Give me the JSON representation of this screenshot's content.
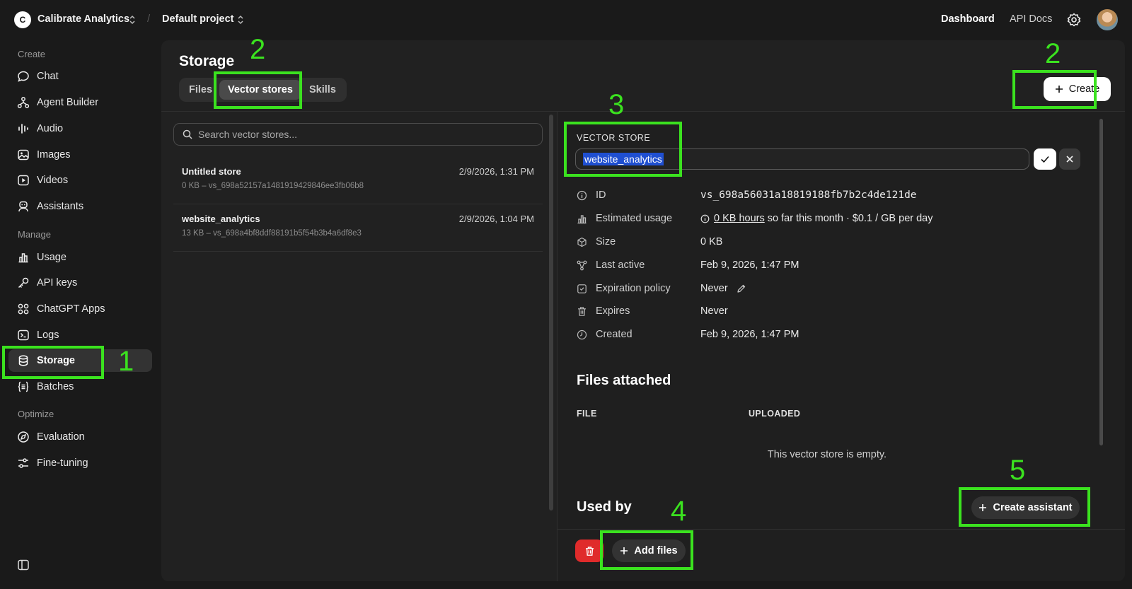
{
  "topbar": {
    "org_initial": "C",
    "org_name": "Calibrate Analytics",
    "separator": "/",
    "project_name": "Default project",
    "nav_dashboard": "Dashboard",
    "nav_api_docs": "API Docs"
  },
  "sidebar": {
    "sections": [
      "Create",
      "Manage",
      "Optimize"
    ],
    "items": [
      {
        "label": "Chat",
        "icon": "chat-icon"
      },
      {
        "label": "Agent Builder",
        "icon": "agent-builder-icon"
      },
      {
        "label": "Audio",
        "icon": "audio-icon"
      },
      {
        "label": "Images",
        "icon": "images-icon"
      },
      {
        "label": "Videos",
        "icon": "videos-icon"
      },
      {
        "label": "Assistants",
        "icon": "assistants-icon"
      },
      {
        "label": "Usage",
        "icon": "usage-icon"
      },
      {
        "label": "API keys",
        "icon": "key-icon"
      },
      {
        "label": "ChatGPT Apps",
        "icon": "apps-icon"
      },
      {
        "label": "Logs",
        "icon": "logs-icon"
      },
      {
        "label": "Storage",
        "icon": "database-icon",
        "active": true
      },
      {
        "label": "Batches",
        "icon": "batches-icon"
      },
      {
        "label": "Evaluation",
        "icon": "evaluation-icon"
      },
      {
        "label": "Fine-tuning",
        "icon": "fine-tuning-icon"
      }
    ]
  },
  "main": {
    "title": "Storage",
    "tabs": [
      {
        "label": "Files"
      },
      {
        "label": "Vector stores",
        "active": true
      },
      {
        "label": "Skills"
      }
    ],
    "create_label": "Create",
    "search_placeholder": "Search vector stores...",
    "stores": [
      {
        "name": "Untitled store",
        "date": "2/9/2026, 1:31 PM",
        "meta": "0 KB – vs_698a52157a1481919429846ee3fb06b8"
      },
      {
        "name": "website_analytics",
        "date": "2/9/2026, 1:04 PM",
        "meta": "13 KB – vs_698a4bf8ddf88191b5f54b3b4a6df8e3"
      }
    ]
  },
  "detail": {
    "section_label": "VECTOR STORE",
    "name_value": "website_analytics",
    "props": [
      {
        "label": "ID",
        "value": "vs_698a56031a18819188fb7b2c4de121de",
        "icon": "info-icon"
      },
      {
        "label": "Estimated usage",
        "value_link": "0 KB hours",
        "value_rest": " so far this month · $0.1 / GB per day",
        "icon": "bar-chart-icon"
      },
      {
        "label": "Size",
        "value": "0 KB",
        "icon": "cube-icon"
      },
      {
        "label": "Last active",
        "value": "Feb 9, 2026, 1:47 PM",
        "icon": "nodes-icon"
      },
      {
        "label": "Expiration policy",
        "value": "Never",
        "icon": "calendar-check-icon"
      },
      {
        "label": "Expires",
        "value": "Never",
        "icon": "trash-icon"
      },
      {
        "label": "Created",
        "value": "Feb 9, 2026, 1:47 PM",
        "icon": "clock-icon"
      }
    ],
    "files_heading": "Files attached",
    "col_file": "FILE",
    "col_uploaded": "UPLOADED",
    "empty_text": "This vector store is empty.",
    "used_by_heading": "Used by",
    "create_assistant_label": "Create assistant",
    "add_files_label": "Add files"
  },
  "annotations": {
    "color": "#3be21f",
    "numbers": [
      "1",
      "2",
      "2",
      "3",
      "4",
      "5"
    ]
  }
}
